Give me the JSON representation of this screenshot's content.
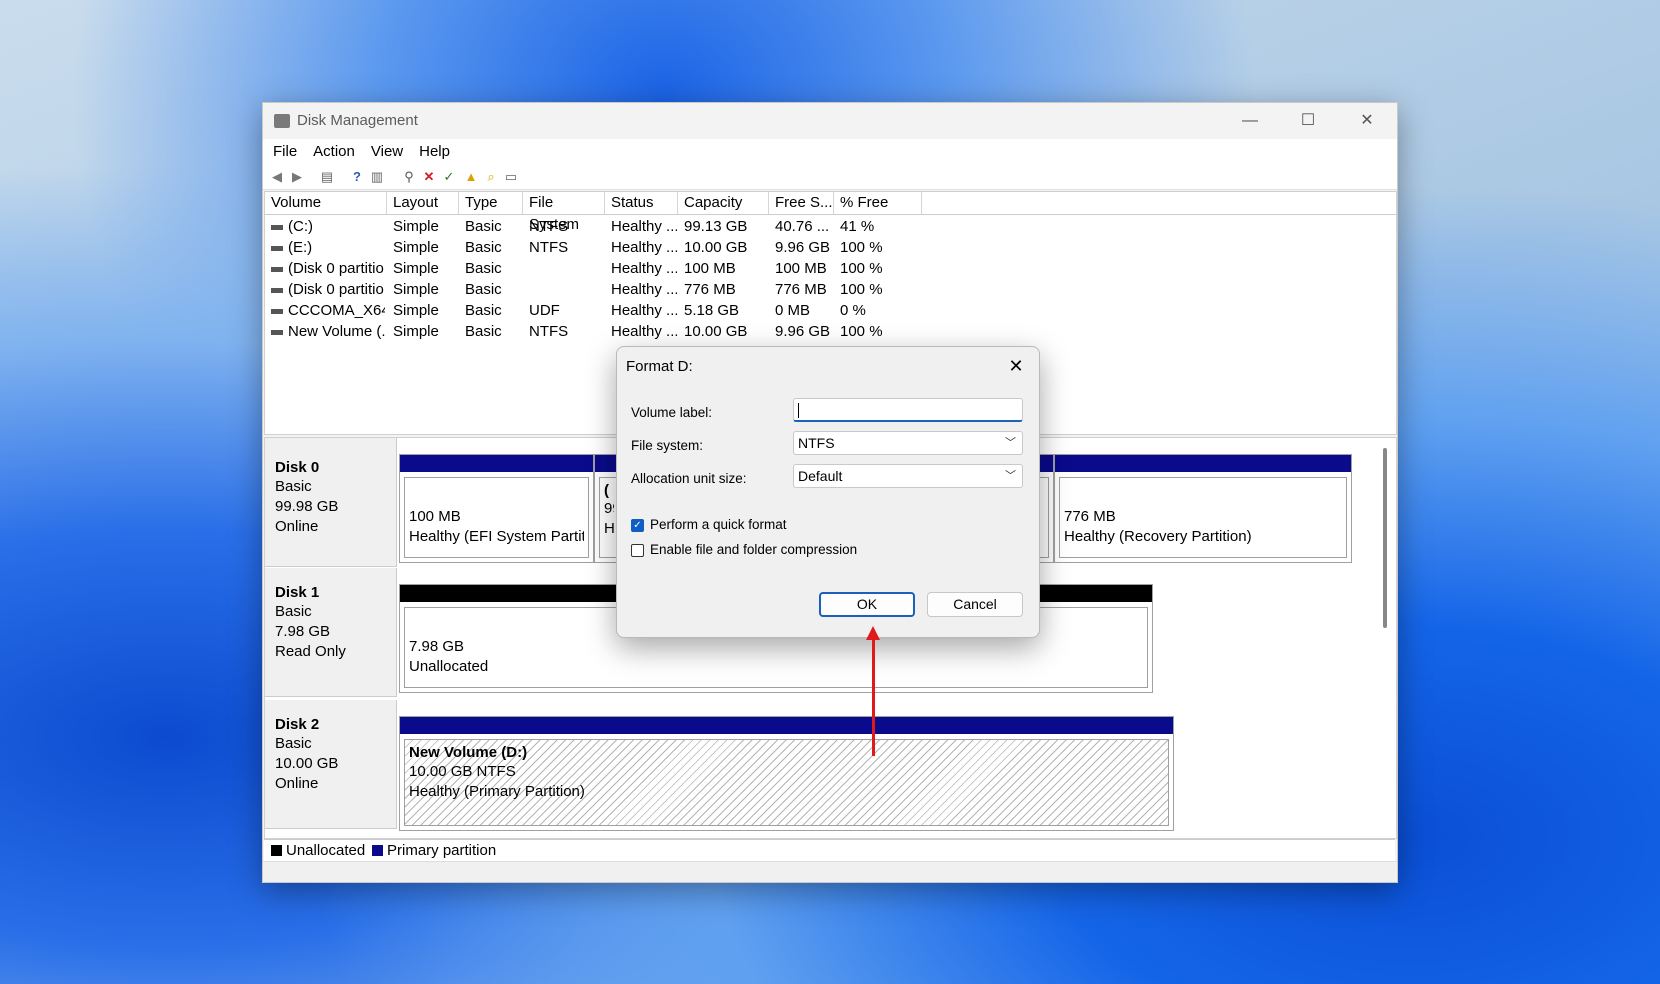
{
  "window": {
    "title": "Disk Management",
    "controls": {
      "minimize": "—",
      "maximize": "☐",
      "close": "✕"
    }
  },
  "menu": [
    "File",
    "Action",
    "View",
    "Help"
  ],
  "list": {
    "columns": [
      "Volume",
      "Layout",
      "Type",
      "File System",
      "Status",
      "Capacity",
      "Free S...",
      "% Free"
    ],
    "rows": [
      [
        "(C:)",
        "Simple",
        "Basic",
        "NTFS",
        "Healthy ...",
        "99.13 GB",
        "40.76 ...",
        "41 %"
      ],
      [
        "(E:)",
        "Simple",
        "Basic",
        "NTFS",
        "Healthy ...",
        "10.00 GB",
        "9.96 GB",
        "100 %"
      ],
      [
        "(Disk 0 partitio...",
        "Simple",
        "Basic",
        "",
        "Healthy ...",
        "100 MB",
        "100 MB",
        "100 %"
      ],
      [
        "(Disk 0 partitio...",
        "Simple",
        "Basic",
        "",
        "Healthy ...",
        "776 MB",
        "776 MB",
        "100 %"
      ],
      [
        "CCCOMA_X64...",
        "Simple",
        "Basic",
        "UDF",
        "Healthy ...",
        "5.18 GB",
        "0 MB",
        "0 %"
      ],
      [
        "New Volume (...",
        "Simple",
        "Basic",
        "NTFS",
        "Healthy ...",
        "10.00 GB",
        "9.96 GB",
        "100 %"
      ]
    ]
  },
  "disks": [
    {
      "name": "Disk 0",
      "type": "Basic",
      "size": "99.98 GB",
      "state": "Online",
      "parts": [
        {
          "line1": "100 MB",
          "line2": "Healthy (EFI System Partitio"
        },
        {
          "line1": "99",
          "line2": "He",
          "bold": "("
        },
        {
          "line1": "776 MB",
          "line2": "Healthy (Recovery Partition)"
        }
      ]
    },
    {
      "name": "Disk 1",
      "type": "Basic",
      "size": "7.98 GB",
      "state": "Read Only",
      "parts": [
        {
          "line1": "7.98 GB",
          "line2": "Unallocated"
        }
      ]
    },
    {
      "name": "Disk 2",
      "type": "Basic",
      "size": "10.00 GB",
      "state": "Online",
      "parts": [
        {
          "title": "New Volume  (D:)",
          "line1": "10.00 GB NTFS",
          "line2": "Healthy (Primary Partition)"
        }
      ]
    }
  ],
  "legend": {
    "unallocated": "Unallocated",
    "primary": "Primary partition"
  },
  "colors": {
    "primary": "#0a0a8c",
    "unallocated": "#000000",
    "accent": "#1a62b8",
    "annotation": "#e0191b"
  },
  "dialog": {
    "title": "Format D:",
    "volume_label": {
      "label": "Volume label:",
      "value": ""
    },
    "file_system": {
      "label": "File system:",
      "value": "NTFS"
    },
    "allocation": {
      "label": "Allocation unit size:",
      "value": "Default"
    },
    "quick_format": {
      "label": "Perform a quick format",
      "checked": true
    },
    "compression": {
      "label": "Enable file and folder compression",
      "checked": false
    },
    "ok": "OK",
    "cancel": "Cancel"
  }
}
